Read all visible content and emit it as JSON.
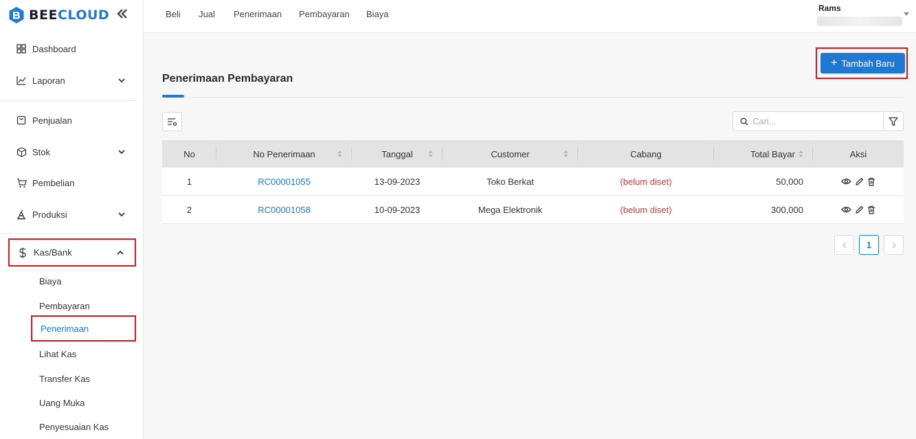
{
  "app": {
    "logo_text_a": "BEE",
    "logo_text_b": "CLOUD"
  },
  "sidebar": {
    "items": [
      {
        "label": "Dashboard"
      },
      {
        "label": "Laporan"
      },
      {
        "label": "Penjualan"
      },
      {
        "label": "Stok"
      },
      {
        "label": "Pembelian"
      },
      {
        "label": "Produksi"
      },
      {
        "label": "Kas/Bank"
      }
    ],
    "sub_items": [
      {
        "label": "Biaya"
      },
      {
        "label": "Pembayaran"
      },
      {
        "label": "Penerimaan"
      },
      {
        "label": "Lihat Kas"
      },
      {
        "label": "Transfer Kas"
      },
      {
        "label": "Uang Muka"
      },
      {
        "label": "Penyesuaian Kas"
      }
    ]
  },
  "topnav": {
    "items": [
      "Beli",
      "Jual",
      "Penerimaan",
      "Pembayaran",
      "Biaya"
    ]
  },
  "user": {
    "name": "Rams"
  },
  "toolbar": {
    "add_label": "Tambah Baru"
  },
  "page": {
    "title": "Penerimaan Pembayaran"
  },
  "search": {
    "placeholder": "Cari..."
  },
  "table": {
    "headers": [
      "No",
      "No Penerimaan",
      "Tanggal",
      "Customer",
      "Cabang",
      "Total Bayar",
      "Aksi"
    ],
    "rows": [
      {
        "no": "1",
        "number": "RC00001055",
        "date": "13-09-2023",
        "customer": "Toko Berkat",
        "branch": "(belum diset)",
        "total": "50,000"
      },
      {
        "no": "2",
        "number": "RC00001058",
        "date": "10-09-2023",
        "customer": "Mega Elektronik",
        "branch": "(belum diset)",
        "total": "300,000"
      }
    ]
  },
  "pagination": {
    "current": "1"
  },
  "colors": {
    "accent": "#1f78d1",
    "highlight": "#e2141a",
    "unset": "#d0383c"
  }
}
